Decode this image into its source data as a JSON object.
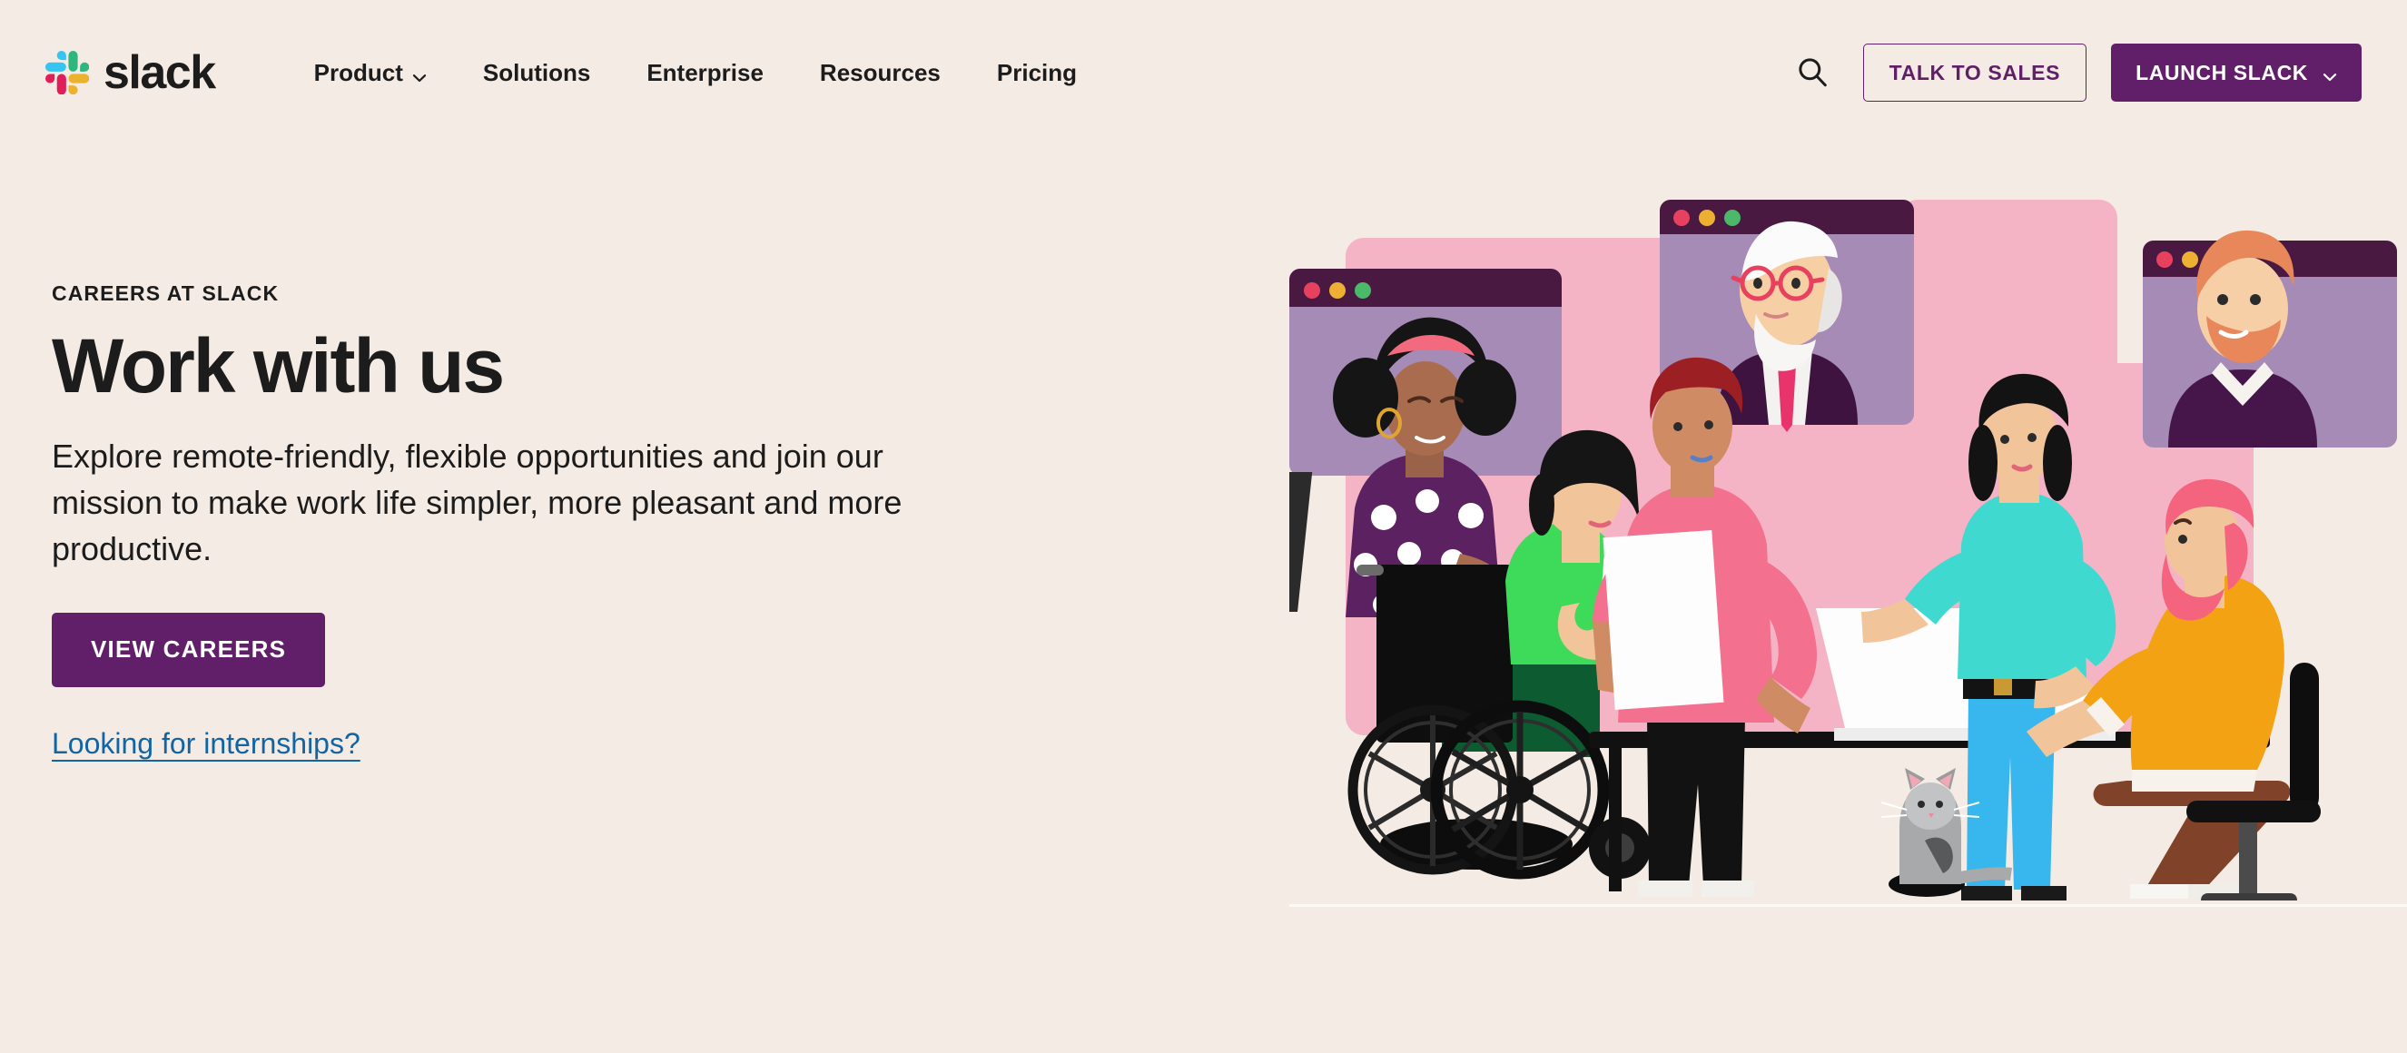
{
  "brand": {
    "name": "slack",
    "logo_colors": [
      "#36c5f0",
      "#2eb67d",
      "#ecb22e",
      "#e01e5a"
    ]
  },
  "nav": {
    "items": [
      {
        "label": "Product",
        "has_dropdown": true
      },
      {
        "label": "Solutions",
        "has_dropdown": false
      },
      {
        "label": "Enterprise",
        "has_dropdown": false
      },
      {
        "label": "Resources",
        "has_dropdown": false
      },
      {
        "label": "Pricing",
        "has_dropdown": false
      }
    ]
  },
  "header_actions": {
    "search_icon": "search-icon",
    "talk_to_sales": "TALK TO SALES",
    "launch_slack": "LAUNCH SLACK",
    "launch_chevron": "chevron-down-icon"
  },
  "hero": {
    "eyebrow": "CAREERS AT SLACK",
    "title": "Work with us",
    "subtitle": "Explore remote-friendly, flexible opportunities and join our mission to make work life simpler, more pleasant and more productive.",
    "cta_label": "VIEW CAREERS",
    "secondary_link": "Looking for internships?"
  },
  "illustration": {
    "alt": "Team of colleagues collaborating around a desk with video-call windows",
    "panel_color": "#f4b4c6",
    "window_bar_color": "#4a1942",
    "window_body_color": "#a58bb5",
    "dots": [
      "#e8415f",
      "#eeb033",
      "#4cb86a"
    ]
  },
  "colors": {
    "page_background": "#f4ece4",
    "brand_purple": "#611f69",
    "link_blue": "#1264a3",
    "text": "#1d1c1d"
  }
}
